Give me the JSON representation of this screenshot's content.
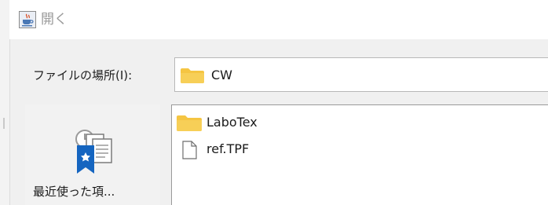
{
  "window": {
    "title": "開く",
    "app_icon": "java-cup-icon"
  },
  "lookin": {
    "label": "ファイルの場所(I):",
    "value": "CW",
    "icon": "folder-icon"
  },
  "places": [
    {
      "label": "最近使った項...",
      "icon": "recent-items-icon"
    }
  ],
  "files": [
    {
      "name": "LaboTex",
      "type": "folder",
      "icon": "folder-icon"
    },
    {
      "name": "ref.TPF",
      "type": "file",
      "icon": "document-icon"
    }
  ],
  "colors": {
    "folder": "#f5c542",
    "bookmark_blue": "#1565c0"
  }
}
